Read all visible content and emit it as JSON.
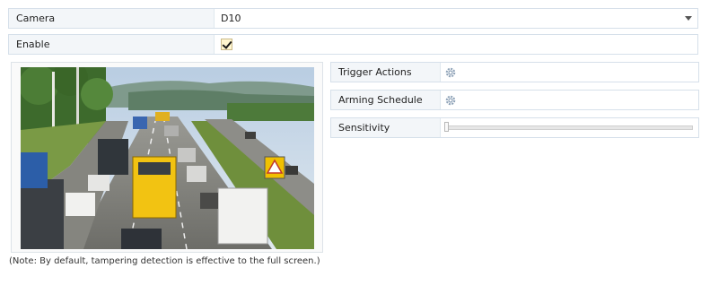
{
  "camera": {
    "label": "Camera",
    "value": "D10"
  },
  "enable": {
    "label": "Enable",
    "checked": true
  },
  "note": "(Note: By default, tampering detection is effective to the full screen.)",
  "trigger_actions": {
    "label": "Trigger Actions",
    "icon": "gear-icon"
  },
  "arming_schedule": {
    "label": "Arming Schedule",
    "icon": "gear-icon"
  },
  "sensitivity": {
    "label": "Sensitivity",
    "level": 0
  },
  "colors": {
    "row_border": "#d6e0ea",
    "label_bg": "#f3f6f9",
    "checkbox_bg": "#fff6cf",
    "gear": "#8fa3b8"
  }
}
